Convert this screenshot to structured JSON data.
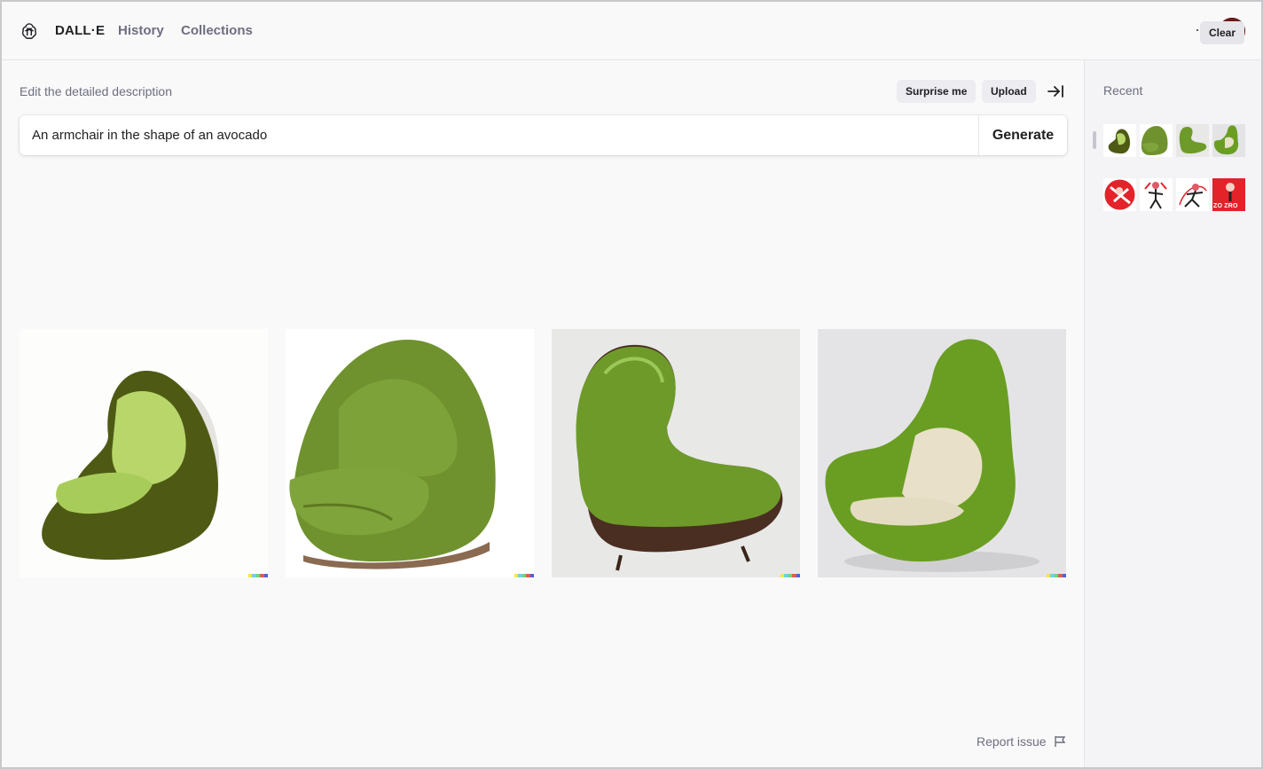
{
  "header": {
    "brand": "DALL·E",
    "nav": [
      "History",
      "Collections"
    ],
    "more_icon": "ellipsis-icon",
    "logo_icon": "openai-logo-icon"
  },
  "editor": {
    "label": "Edit the detailed description",
    "surprise_label": "Surprise me",
    "upload_label": "Upload",
    "prompt_value": "An armchair in the shape of an avocado",
    "generate_label": "Generate"
  },
  "results": {
    "images": [
      "avocado-chair-dark-green-velvet",
      "avocado-chair-green-leather",
      "avocado-chair-brown-base",
      "avocado-chair-cream-cushion"
    ]
  },
  "footer": {
    "report_label": "Report issue"
  },
  "sidebar": {
    "recent_label": "Recent",
    "clear_label": "Clear",
    "recent_items": [
      "avocado-chair-thumbnail",
      "avocado-chair-thumbnail",
      "avocado-chair-thumbnail",
      "avocado-chair-thumbnail",
      "anime-character-thumbnail",
      "anime-character-thumbnail",
      "anime-character-thumbnail",
      "anime-character-thumbnail"
    ],
    "thumb_text": "ZO ZRO"
  },
  "colors": {
    "accent_green": "#6f9a2e",
    "dark_green": "#4a5a14",
    "text_secondary": "#6e6e80",
    "button_bg": "#ececf1"
  }
}
